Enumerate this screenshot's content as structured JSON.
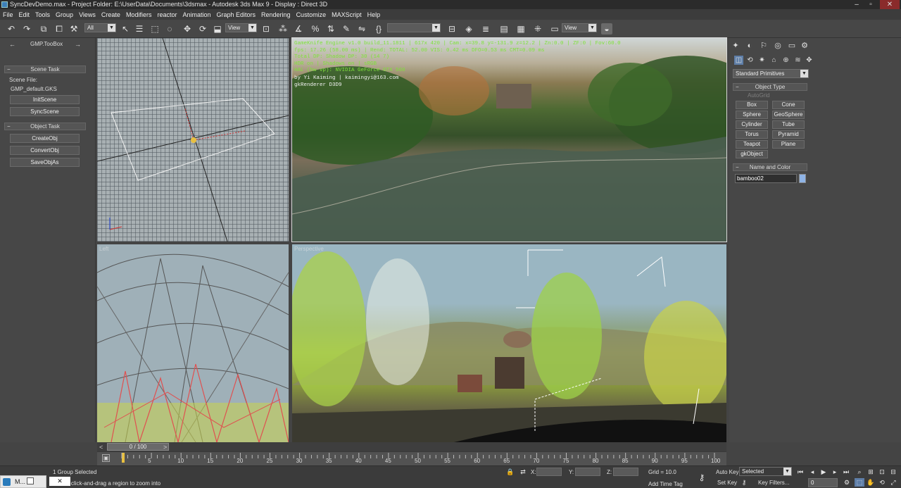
{
  "window": {
    "title": "SyncDevDemo.max    - Project Folder: E:\\UserData\\Documents\\3dsmax     - Autodesk 3ds Max 9        - Display : Direct 3D"
  },
  "menu": [
    "File",
    "Edit",
    "Tools",
    "Group",
    "Views",
    "Create",
    "Modifiers",
    "reactor",
    "Animation",
    "Graph Editors",
    "Rendering",
    "Customize",
    "MAXScript",
    "Help"
  ],
  "toolbar": {
    "selection_filter": "All",
    "ref_coord": "View",
    "named_selection": "",
    "render_view": "View"
  },
  "gmp_toolbox": {
    "title": "GMP.TooBox",
    "prev": "←",
    "next": "→",
    "scene_task": {
      "header": "Scene Task",
      "scene_file_label": "Scene File:",
      "scene_file_value": "GMP_default.GKS",
      "buttons": [
        "InitScene",
        "SyncScene"
      ]
    },
    "object_task": {
      "header": "Object Task",
      "buttons": [
        "CreateObj",
        "ConvertObj",
        "SaveObjAs"
      ]
    }
  },
  "game_overlay": {
    "green_lines": [
      "GameKnife Engine v1.0 build_11.1811 | 617x 420 | Cam: x=39.8 y=-131.9 z=12.2 | Zn:0.0 | ZF:0 | Fov:60.0",
      "fps: 17.26 (58.00 ms) | Rend: TOTAL: 52.00 VIS: 0.42 ms DFO=0.53 ms CMT=0.09 ms",
      "Total DP: Shadow DP: 30 (14 7)",
      "HDR on | Shadows on | sRGB",
      "HAL (hw vp): NVIDIA GeForce GTX 560"
    ],
    "white_lines": [
      "by Yi Kaiming | kaimingyi@163.com",
      "gkRenderer D3D9"
    ]
  },
  "viewports": {
    "left_label": "Left",
    "persp_label": "Perspective"
  },
  "command_panel": {
    "category": "Standard Primitives",
    "object_type_header": "Object Type",
    "autogrid": "AutoGrid",
    "buttons": [
      "Box",
      "Cone",
      "Sphere",
      "GeoSphere",
      "Cylinder",
      "Tube",
      "Torus",
      "Pyramid",
      "Teapot",
      "Plane",
      "gkObject"
    ],
    "name_color_header": "Name and Color",
    "object_name": "bamboo02",
    "object_color": "#8fb4e6"
  },
  "timeline": {
    "frame_counter": "0 / 100",
    "ticks": [
      "0",
      "5",
      "10",
      "15",
      "20",
      "25",
      "30",
      "35",
      "40",
      "45",
      "50",
      "55",
      "60",
      "65",
      "70",
      "75",
      "80",
      "85",
      "90",
      "95",
      "100"
    ]
  },
  "status": {
    "selection": "1 Group Selected",
    "prompt": "Click or click-and-drag a region to zoom into",
    "x_label": "X:",
    "y_label": "Y:",
    "z_label": "Z:",
    "grid": "Grid = 10.0",
    "add_time_tag": "Add Time Tag",
    "auto_key": "Auto Key",
    "set_key": "Set Key",
    "key_mode": "Selected",
    "key_filters": "Key Filters...",
    "current_frame": "0",
    "taskbar_label": "M..."
  },
  "colors": {
    "overlay_green": "#7fe23a",
    "selection_gizmo": "#e8c040",
    "wire_red": "#e05050"
  }
}
